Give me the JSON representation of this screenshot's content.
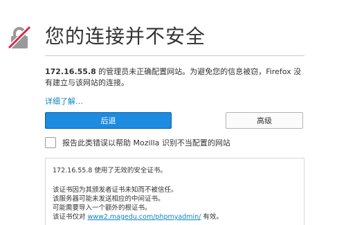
{
  "colors": {
    "primary_button": "#1d8be0",
    "link": "#0a84c7",
    "icon_strike": "#d7264a",
    "icon_lock": "#999999"
  },
  "icons": {
    "header_icon": "broken-lock-icon"
  },
  "page": {
    "title": "您的连接并不安全",
    "desc_host": "172.16.55.8",
    "desc_text": " 的管理员未正确配置网站。为避免您的信息被窃，Firefox 没有建立与该网站的连接。",
    "learn_more": "详细了解…",
    "back_button": "后退",
    "advanced_button": "高级",
    "report_label": "报告此类错误以帮助 Mozilla 识别不当配置的网站"
  },
  "cert_details": {
    "line1": "172.16.55.8 使用了无效的安全证书。",
    "line2": "该证书因为其颁发者证书未知而不被信任。",
    "line3": "该服务器可能未发送相应的中间证书。",
    "line4": "可能需要导入一个额外的根证书。",
    "line5_prefix": "该证书仅对 ",
    "line5_link": "www2.magedu.com/phpmyadmin/",
    "line5_suffix": " 有效。"
  }
}
